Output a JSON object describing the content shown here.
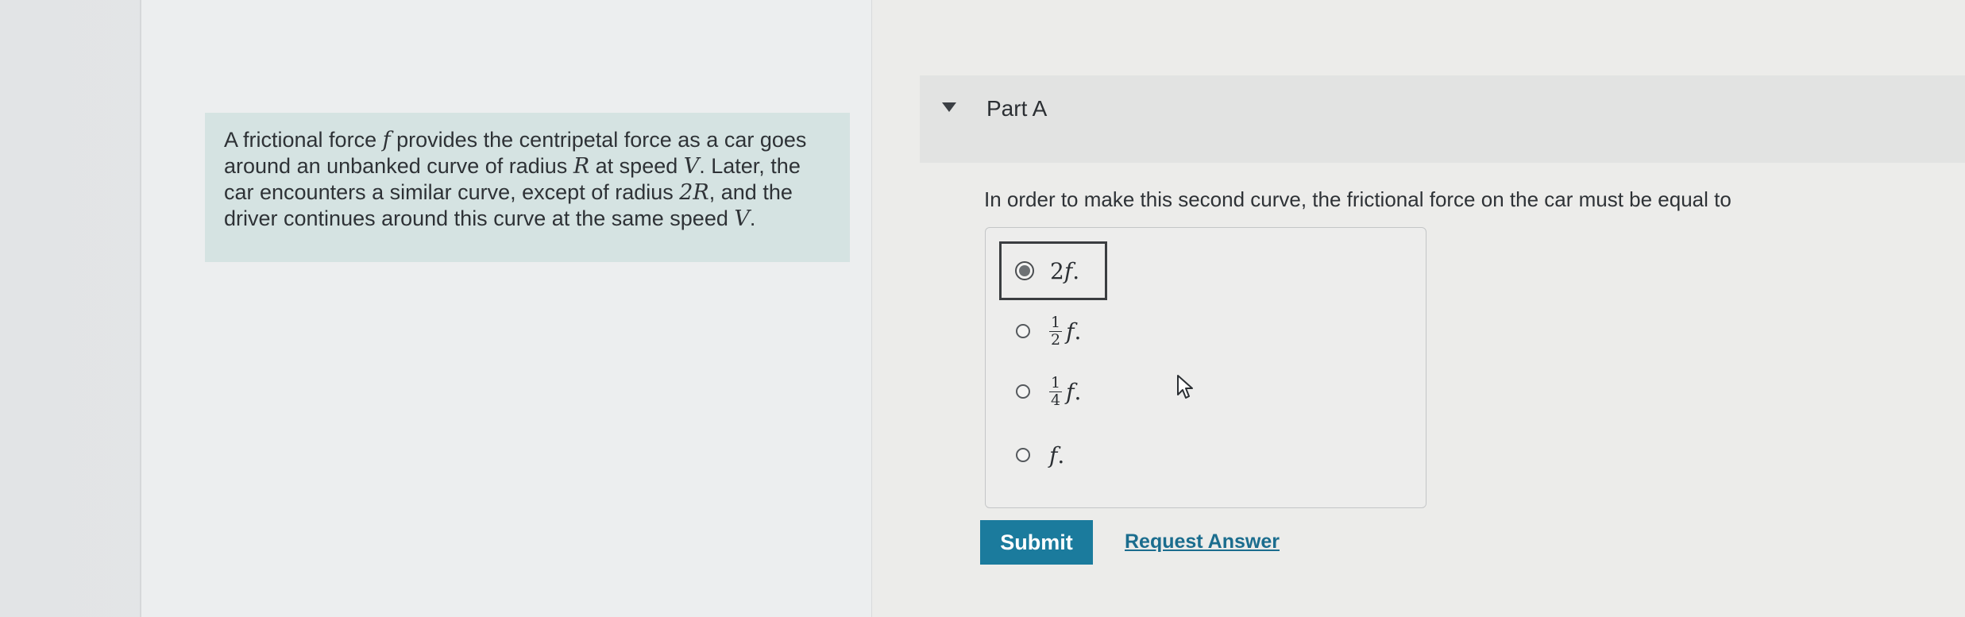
{
  "problem": {
    "line1_a": "A frictional force ",
    "line1_var": "f",
    "line1_b": " provides the centripetal force as a car goes",
    "line2_a": "around an unbanked curve of radius ",
    "line2_var": "R",
    "line2_b": " at speed ",
    "line2_var2": "V",
    "line2_c": ". Later, the",
    "line3_a": "car encounters a similar curve, except of radius ",
    "line3_var": "2R",
    "line3_b": ", and the",
    "line4_a": "driver continues around this curve at the same speed ",
    "line4_var": "V",
    "line4_b": "."
  },
  "part": {
    "title": "Part A"
  },
  "question": {
    "text": "In order to make this second curve, the frictional force on the car must be equal to"
  },
  "options": [
    {
      "coef": "2",
      "var": "f",
      "suffix": ".",
      "selected": true
    },
    {
      "num": "1",
      "den": "2",
      "var": "f",
      "suffix": ".",
      "selected": false
    },
    {
      "num": "1",
      "den": "4",
      "var": "f",
      "suffix": ".",
      "selected": false
    },
    {
      "var": "f",
      "suffix": ".",
      "selected": false
    }
  ],
  "actions": {
    "submit_label": "Submit",
    "request_label": "Request Answer"
  },
  "colors": {
    "accent": "#1b7b9d",
    "problem_bg": "#d5e3e2",
    "link": "#1b6d8e"
  }
}
